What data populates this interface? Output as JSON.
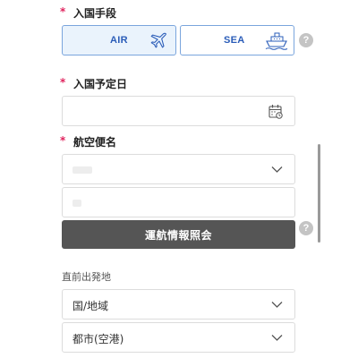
{
  "entry_method": {
    "required_mark": "*",
    "label": "入国手段",
    "options": [
      {
        "label": "AIR",
        "icon": "airplane-icon",
        "selected": true
      },
      {
        "label": "SEA",
        "icon": "ship-icon",
        "selected": false
      }
    ],
    "help": "?"
  },
  "entry_date": {
    "required_mark": "*",
    "label": "入国予定日",
    "value": "",
    "icon": "calendar-icon"
  },
  "flight": {
    "required_mark": "*",
    "label": "航空便名",
    "airline_value": "",
    "number_value": "",
    "check_button": "運航情報照会",
    "help": "?"
  },
  "departure": {
    "label": "直前出発地",
    "country_value": "国/地域",
    "city_value": "都市(空港)"
  },
  "colors": {
    "required": "#e0245e",
    "accent": "#2a5cb8",
    "selected_bg": "#eaf3fc",
    "button_bg": "#555555"
  }
}
